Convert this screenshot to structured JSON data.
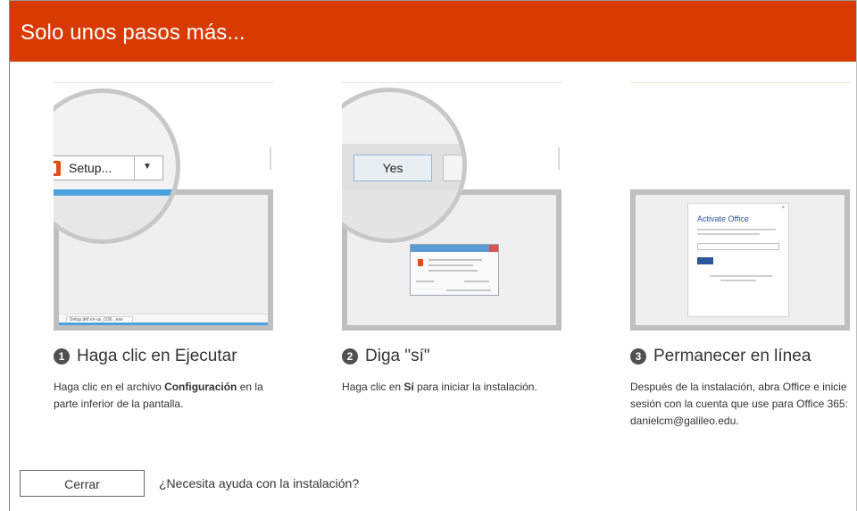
{
  "header": {
    "title": "Solo unos pasos más..."
  },
  "colors": {
    "header_bg": "#d83b01",
    "accent_blue": "#4aa3df",
    "office_orange": "#e44d13"
  },
  "steps": [
    {
      "number": "1",
      "title": "Haga clic en Ejecutar",
      "desc_prefix": "Haga clic en el archivo ",
      "desc_bold": "Configuración",
      "desc_suffix": " en la parte inferior de la pantalla.",
      "illustration": {
        "button_label": "Setup...",
        "caret_icon": "chevron-down-icon",
        "taskbar_label": "Setup.def.en-us_O36...exe"
      }
    },
    {
      "number": "2",
      "title": "Diga \"sí\"",
      "desc_prefix": "Haga clic en ",
      "desc_bold": "Sí",
      "desc_suffix": " para iniciar la instalación.",
      "illustration": {
        "button_label": "Yes"
      }
    },
    {
      "number": "3",
      "title": "Permanecer en línea",
      "desc": "Después de la instalación, abra Office e inicie sesión con la cuenta que use para Office 365: danielcm@galileo.edu.",
      "illustration": {
        "card_title": "Activate Office"
      }
    }
  ],
  "footer": {
    "close_label": "Cerrar",
    "help_label": "¿Necesita ayuda con la instalación?"
  }
}
